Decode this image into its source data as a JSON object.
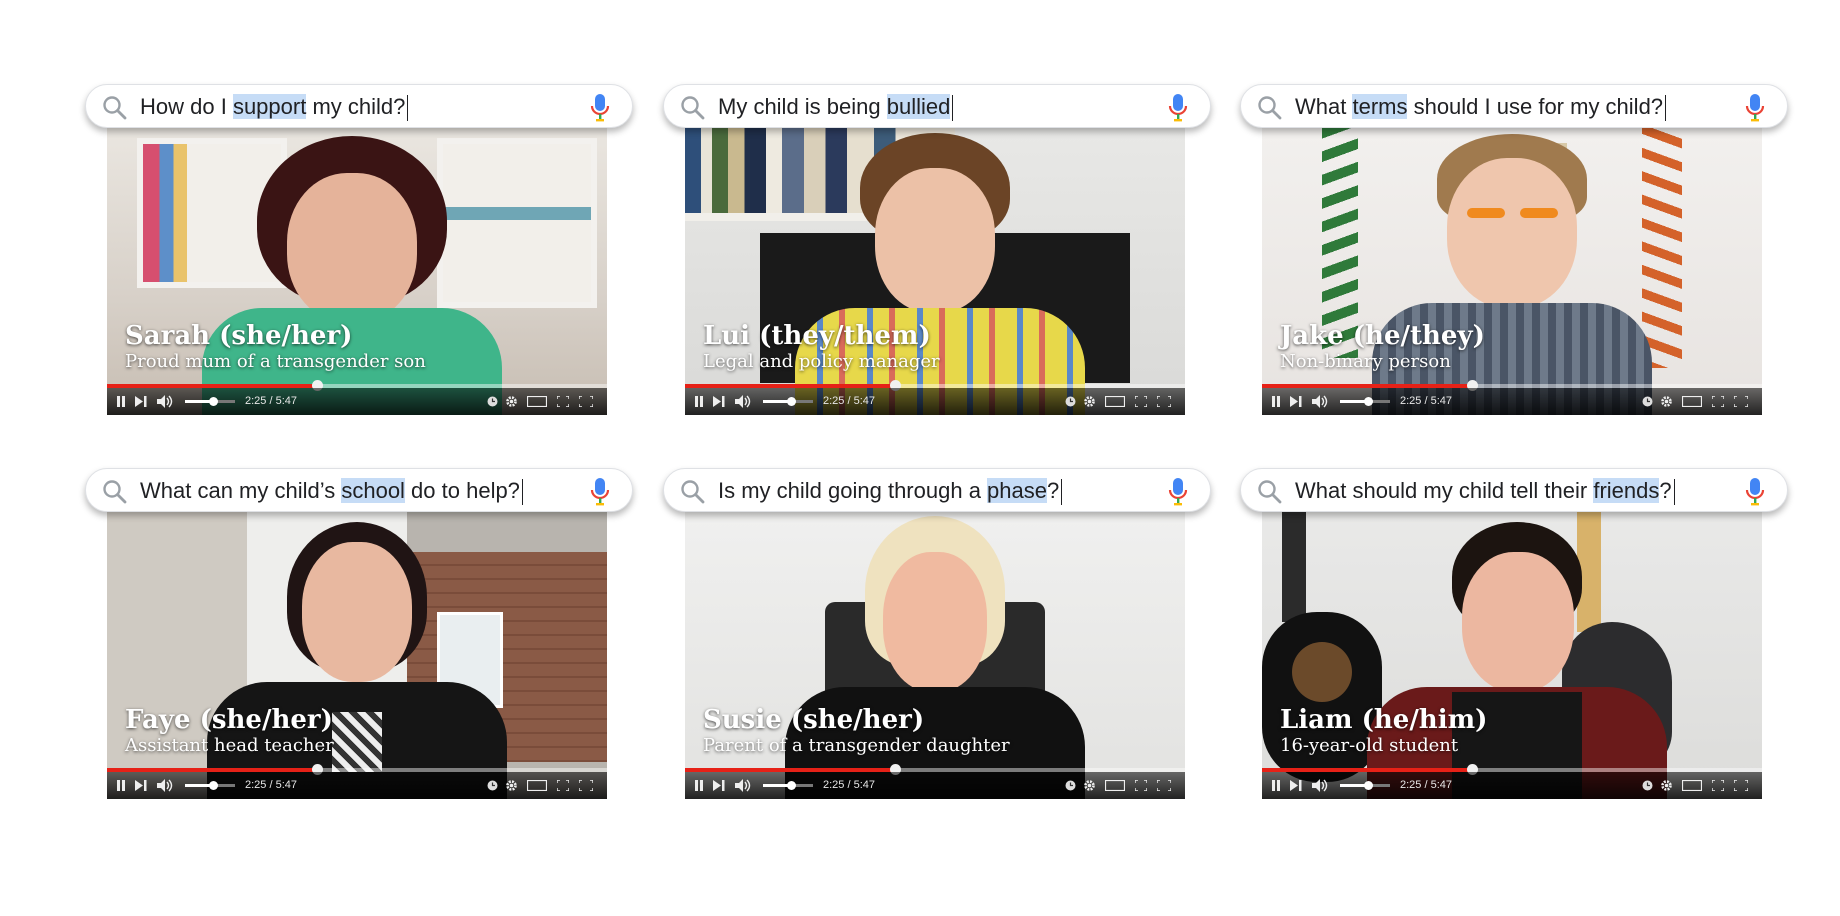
{
  "cards": [
    {
      "query": {
        "pre": "How do I ",
        "hl": "support",
        "post": " my child?"
      },
      "name": "Sarah (she/her)",
      "role": "Proud mum of a transgender son",
      "time": "2:25 / 5:47"
    },
    {
      "query": {
        "pre": "My child is being ",
        "hl": "bullied",
        "post": ""
      },
      "name": "Lui (they/them)",
      "role": "Legal and policy manager",
      "time": "2:25 / 5:47"
    },
    {
      "query": {
        "pre": "What ",
        "hl": "terms",
        "post": " should I use for my child?"
      },
      "name": "Jake (he/they)",
      "role": "Non-binary person",
      "time": "2:25 / 5:47"
    },
    {
      "query": {
        "pre": "What can my child’s ",
        "hl": "school",
        "post": " do to help?"
      },
      "name": "Faye (she/her)",
      "role": "Assistant head teacher",
      "time": "2:25 / 5:47"
    },
    {
      "query": {
        "pre": "Is my child going through a ",
        "hl": "phase",
        "post": "?"
      },
      "name": "Susie (she/her)",
      "role": "Parent of a transgender daughter",
      "time": "2:25 / 5:47"
    },
    {
      "query": {
        "pre": "What should my child tell their ",
        "hl": "friends",
        "post": "?"
      },
      "name": "Liam (he/him)",
      "role": "16-year-old student",
      "time": "2:25 / 5:47"
    }
  ],
  "playback": {
    "progress_fraction": 0.42,
    "volume_fraction": 0.55
  },
  "icons": {
    "search": "magnifier-icon",
    "voice": "microphone-icon",
    "controls": [
      "pause-icon",
      "next-icon",
      "volume-icon",
      "clock-icon",
      "settings-gear-icon",
      "theater-mode-icon",
      "fullscreen-icon"
    ]
  },
  "colors": {
    "highlight": "#c6dcf6",
    "progress": "#e62117",
    "mic_blue": "#4285f4",
    "mic_red": "#ea4335"
  }
}
